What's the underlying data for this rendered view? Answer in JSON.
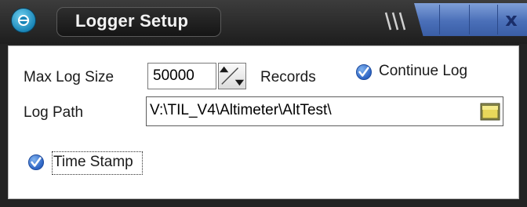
{
  "window": {
    "title": "Logger Setup",
    "close_label": "x",
    "grip_label": "\\\\\\"
  },
  "form": {
    "max_log_size_label": "Max Log Size",
    "max_log_size_value": "50000",
    "records_label": "Records",
    "continue_log_label": "Continue Log",
    "continue_log_checked": true,
    "log_path_label": "Log Path",
    "log_path_value": "V:\\TIL_V4\\Altimeter\\AltTest\\",
    "time_stamp_label": "Time Stamp",
    "time_stamp_checked": true
  },
  "icons": {
    "app": "app-logo-icon",
    "spinner": "up-down-arrow-icon",
    "folder": "folder-icon",
    "checkmark": "check-icon",
    "close": "close-icon"
  },
  "colors": {
    "titlebar": "#232323",
    "titlebar_accent": "#4a6fb8",
    "panel": "#ffffff",
    "checkbox": "#2d64c4",
    "folder": "#e8d85a"
  }
}
